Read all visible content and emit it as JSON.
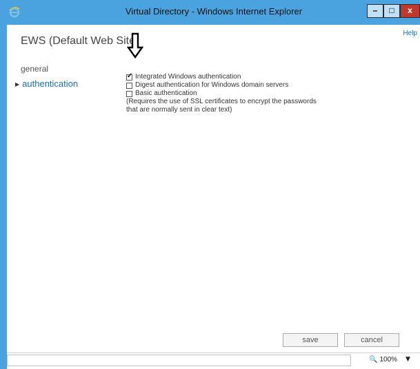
{
  "window": {
    "title": "Virtual Directory - Windows Internet Explorer",
    "minimize": "–",
    "maximize": "□",
    "close": "x"
  },
  "page": {
    "help": "Help",
    "title": "EWS (Default Web Site)"
  },
  "nav": {
    "items": [
      {
        "label": "general"
      },
      {
        "label": "authentication"
      }
    ]
  },
  "auth": {
    "options": [
      {
        "label": "Integrated Windows authentication",
        "checked": true
      },
      {
        "label": "Digest authentication for Windows domain servers",
        "checked": false
      },
      {
        "label": "Basic authentication",
        "checked": false
      }
    ],
    "note_line1": "(Requires the use of SSL certificates to encrypt the passwords",
    "note_line2": "that are normally sent in clear text)"
  },
  "buttons": {
    "save": "save",
    "cancel": "cancel"
  },
  "status": {
    "zoom": "100%"
  }
}
